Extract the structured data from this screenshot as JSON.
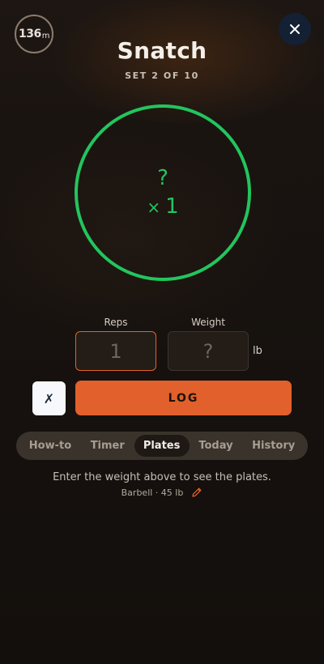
{
  "header": {
    "timer_value": "136",
    "timer_unit": "m",
    "close_icon": "close-icon"
  },
  "exercise": {
    "title": "Snatch",
    "set_label": "SET 2 OF 10"
  },
  "ring": {
    "weight_display": "?",
    "times_symbol": "×",
    "reps_display": "1",
    "color": "#22c55e"
  },
  "inputs": {
    "reps_label": "Reps",
    "reps_placeholder": "1",
    "weight_label": "Weight",
    "weight_placeholder": "?",
    "weight_unit": "lb"
  },
  "actions": {
    "cancel_label": "✗",
    "log_label": "LOG",
    "accent_color": "#e2602b"
  },
  "tabs": [
    {
      "label": "How-to",
      "active": false
    },
    {
      "label": "Timer",
      "active": false
    },
    {
      "label": "Plates",
      "active": true
    },
    {
      "label": "Today",
      "active": false
    },
    {
      "label": "History",
      "active": false
    }
  ],
  "plates": {
    "hint": "Enter the weight above to see the plates.",
    "barbell_info": "Barbell · 45 lb",
    "edit_icon": "pencil-icon"
  }
}
